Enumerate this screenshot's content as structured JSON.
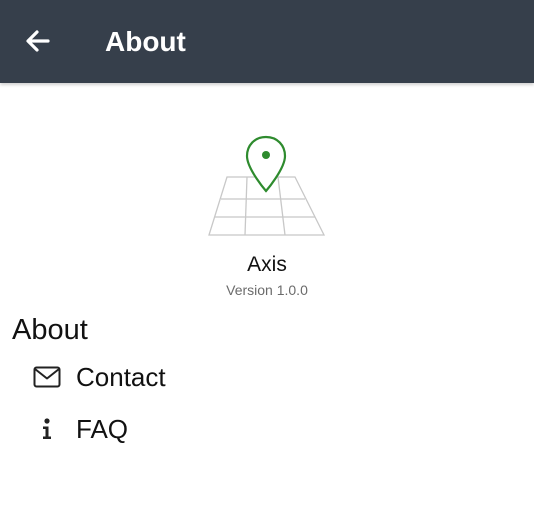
{
  "appbar": {
    "title": "About",
    "back_icon": "arrow-left-icon",
    "background": "#363f4b"
  },
  "app": {
    "name": "Axis",
    "version": "Version 1.0.0",
    "logo_icon": "map-pin-grid-logo",
    "accent_color": "#2e8b2e"
  },
  "section": {
    "title": "About"
  },
  "items": [
    {
      "label": "Contact",
      "icon": "mail-icon"
    },
    {
      "label": "FAQ",
      "icon": "info-icon"
    }
  ]
}
